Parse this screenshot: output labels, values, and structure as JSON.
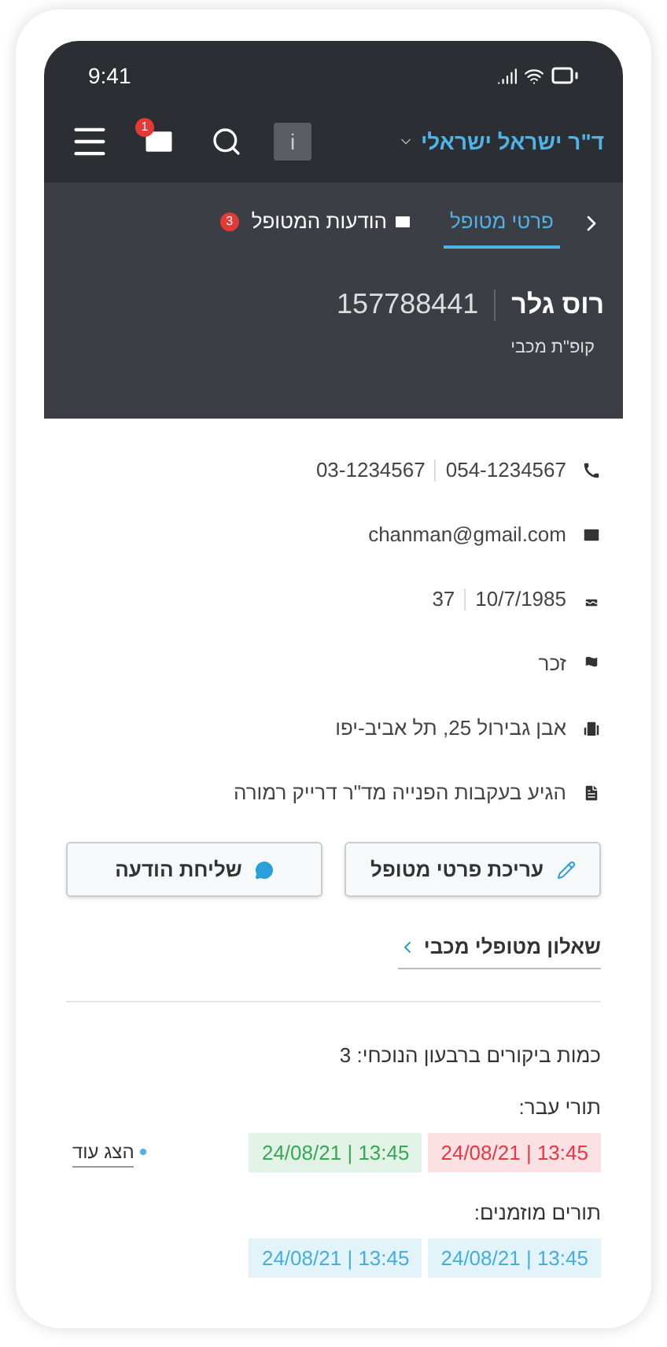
{
  "status_bar": {
    "time": "9:41"
  },
  "top_bar": {
    "user": "ד\"ר ישראל ישראלי",
    "mail_badge": "1",
    "info_label": "i"
  },
  "tabs": [
    {
      "label": "פרטי מטופל",
      "selected": true
    },
    {
      "label": "הודעות המטופל",
      "selected": false,
      "badge": "3"
    }
  ],
  "patient": {
    "name": "רוס גלר",
    "id": "157788441",
    "hmo": "קופ\"ת מכבי"
  },
  "details": [
    {
      "kind": "phone",
      "parts": [
        "054-1234567",
        "03-1234567"
      ]
    },
    {
      "kind": "email",
      "parts": [
        "chanman@gmail.com"
      ]
    },
    {
      "kind": "birth",
      "parts": [
        "10/7/1985",
        "37"
      ]
    },
    {
      "kind": "gender",
      "parts": [
        "זכר"
      ]
    },
    {
      "kind": "address",
      "parts": [
        "אבן גבירול 25, תל אביב-יפו"
      ]
    },
    {
      "kind": "referral",
      "parts": [
        "הגיע בעקבות הפנייה מד\"ר דרייק רמורה"
      ]
    }
  ],
  "buttons": [
    {
      "kind": "edit",
      "label": "עריכת פרטי מטופל"
    },
    {
      "kind": "message",
      "label": "שליחת הודעה"
    }
  ],
  "questionnaire_link": "שאלון מטופלי מכבי",
  "visits_count": "כמות ביקורים ברבעון הנוכחי: 3",
  "past_appointments": {
    "title": "תורי עבר:",
    "show_more": "הצג עוד",
    "items": [
      {
        "text": "13:45 | 24/08/21",
        "color": "#e53945"
      },
      {
        "text": "13:45 | 24/08/21",
        "color": "#3aa757"
      }
    ]
  },
  "booked_appointments": {
    "title": "תורים מוזמנים:",
    "items": [
      {
        "text": "13:45 | 24/08/21",
        "color": "#45aee0"
      },
      {
        "text": "13:45 | 24/08/21",
        "color": "#45aee0"
      }
    ]
  }
}
